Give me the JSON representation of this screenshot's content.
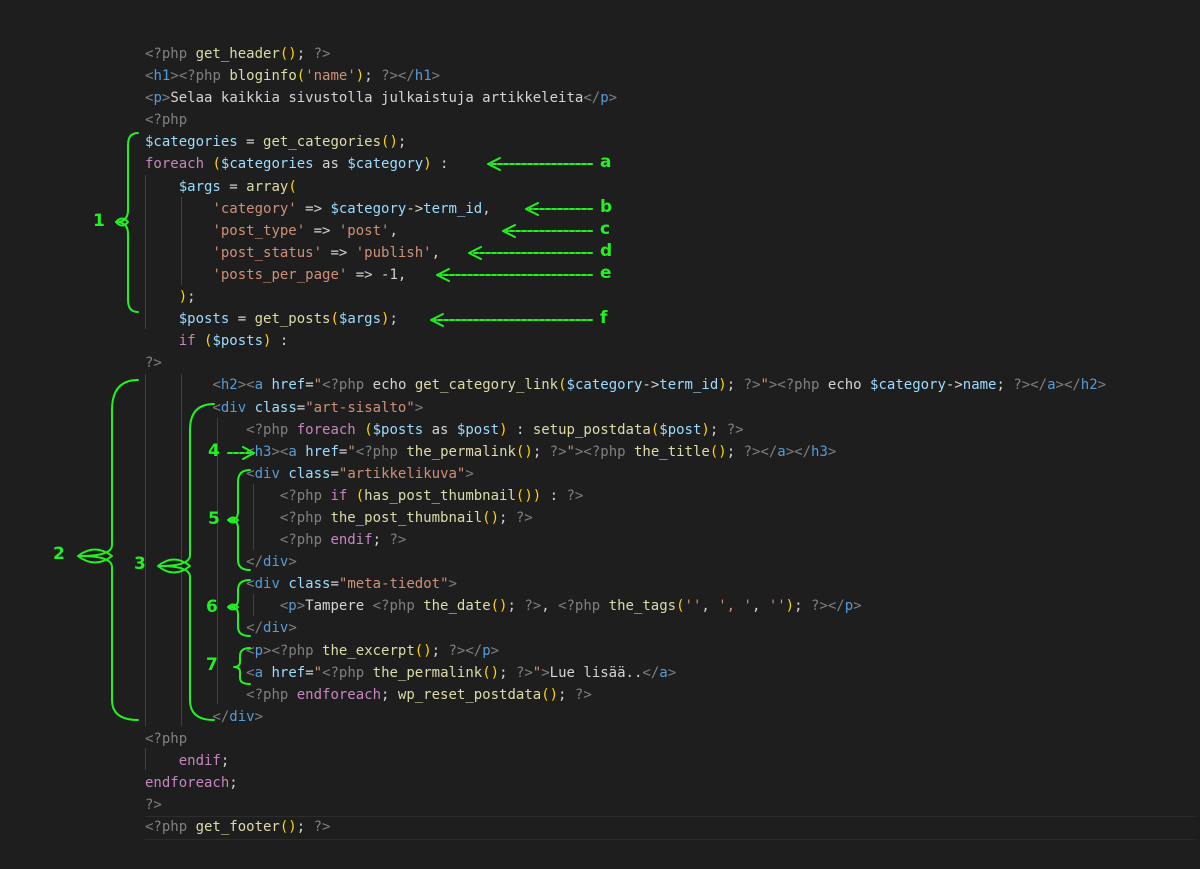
{
  "editor": {
    "lines": [
      [
        [
          "tg",
          "<?php "
        ],
        [
          "fn",
          "get_header"
        ],
        [
          "pn",
          "()"
        ],
        [
          "tx",
          "; "
        ],
        [
          "tg",
          "?>"
        ]
      ],
      [
        [
          "tg",
          "<"
        ],
        [
          "tn",
          "h1"
        ],
        [
          "tg",
          ">"
        ],
        [
          "tg",
          "<?php "
        ],
        [
          "fn",
          "bloginfo"
        ],
        [
          "pn",
          "("
        ],
        [
          "st",
          "'name'"
        ],
        [
          "pn",
          ")"
        ],
        [
          "tx",
          "; "
        ],
        [
          "tg",
          "?>"
        ],
        [
          "tg",
          "</"
        ],
        [
          "tn",
          "h1"
        ],
        [
          "tg",
          ">"
        ]
      ],
      [
        [
          "tg",
          "<"
        ],
        [
          "tn",
          "p"
        ],
        [
          "tg",
          ">"
        ],
        [
          "tx",
          "Selaa kaikkia sivustolla julkaistuja artikkeleita"
        ],
        [
          "tg",
          "</"
        ],
        [
          "tn",
          "p"
        ],
        [
          "tg",
          ">"
        ]
      ],
      [
        [
          "tg",
          "<?php"
        ]
      ],
      [
        [
          "at",
          "$categories"
        ],
        [
          "tx",
          " = "
        ],
        [
          "fn",
          "get_categories"
        ],
        [
          "pn",
          "()"
        ],
        [
          "tx",
          ";"
        ]
      ],
      [
        [
          "kw",
          "foreach"
        ],
        [
          "tx",
          " "
        ],
        [
          "pn",
          "("
        ],
        [
          "at",
          "$categories"
        ],
        [
          "tx",
          " as "
        ],
        [
          "at",
          "$category"
        ],
        [
          "pn",
          ")"
        ],
        [
          "tx",
          " :"
        ]
      ],
      [
        [
          "tx",
          "    "
        ],
        [
          "at",
          "$args"
        ],
        [
          "tx",
          " = "
        ],
        [
          "fn",
          "array"
        ],
        [
          "pn",
          "("
        ]
      ],
      [
        [
          "tx",
          "        "
        ],
        [
          "st",
          "'category'"
        ],
        [
          "tx",
          " => "
        ],
        [
          "at",
          "$category"
        ],
        [
          "tx",
          "->"
        ],
        [
          "at",
          "term_id"
        ],
        [
          "tx",
          ","
        ]
      ],
      [
        [
          "tx",
          "        "
        ],
        [
          "st",
          "'post_type'"
        ],
        [
          "tx",
          " => "
        ],
        [
          "st",
          "'post'"
        ],
        [
          "tx",
          ","
        ]
      ],
      [
        [
          "tx",
          "        "
        ],
        [
          "st",
          "'post_status'"
        ],
        [
          "tx",
          " => "
        ],
        [
          "st",
          "'publish'"
        ],
        [
          "tx",
          ","
        ]
      ],
      [
        [
          "tx",
          "        "
        ],
        [
          "st",
          "'posts_per_page'"
        ],
        [
          "tx",
          " => -1,"
        ]
      ],
      [
        [
          "tx",
          "    "
        ],
        [
          "pn",
          ")"
        ],
        [
          "tx",
          ";"
        ]
      ],
      [
        [
          "tx",
          "    "
        ],
        [
          "at",
          "$posts"
        ],
        [
          "tx",
          " = "
        ],
        [
          "fn",
          "get_posts"
        ],
        [
          "pn",
          "("
        ],
        [
          "at",
          "$args"
        ],
        [
          "pn",
          ")"
        ],
        [
          "tx",
          ";"
        ]
      ],
      [
        [
          "tx",
          "    "
        ],
        [
          "kw",
          "if"
        ],
        [
          "tx",
          " "
        ],
        [
          "pn",
          "("
        ],
        [
          "at",
          "$posts"
        ],
        [
          "pn",
          ")"
        ],
        [
          "tx",
          " :"
        ]
      ],
      [
        [
          "tg",
          "?>"
        ]
      ],
      [
        [
          "tx",
          "        "
        ],
        [
          "tg",
          "<"
        ],
        [
          "tn",
          "h2"
        ],
        [
          "tg",
          ">"
        ],
        [
          "tg",
          "<"
        ],
        [
          "tn",
          "a"
        ],
        [
          "tx",
          " "
        ],
        [
          "at",
          "href"
        ],
        [
          "tx",
          "="
        ],
        [
          "st",
          "\""
        ],
        [
          "tg",
          "<?php "
        ],
        [
          "tx",
          "echo "
        ],
        [
          "fn",
          "get_category_link"
        ],
        [
          "pn",
          "("
        ],
        [
          "at",
          "$category"
        ],
        [
          "tx",
          "->"
        ],
        [
          "at",
          "term_id"
        ],
        [
          "pn",
          ")"
        ],
        [
          "tx",
          "; "
        ],
        [
          "tg",
          "?>"
        ],
        [
          "st",
          "\""
        ],
        [
          "tg",
          ">"
        ],
        [
          "tg",
          "<?php "
        ],
        [
          "tx",
          "echo "
        ],
        [
          "at",
          "$category"
        ],
        [
          "tx",
          "->"
        ],
        [
          "at",
          "name"
        ],
        [
          "tx",
          "; "
        ],
        [
          "tg",
          "?>"
        ],
        [
          "tg",
          "</"
        ],
        [
          "tn",
          "a"
        ],
        [
          "tg",
          ">"
        ],
        [
          "tg",
          "</"
        ],
        [
          "tn",
          "h2"
        ],
        [
          "tg",
          ">"
        ]
      ],
      [
        [
          "tx",
          "        "
        ],
        [
          "tg",
          "<"
        ],
        [
          "tn",
          "div"
        ],
        [
          "tx",
          " "
        ],
        [
          "at",
          "class"
        ],
        [
          "tx",
          "="
        ],
        [
          "st",
          "\"art-sisalto\""
        ],
        [
          "tg",
          ">"
        ]
      ],
      [
        [
          "tx",
          "            "
        ],
        [
          "tg",
          "<?php "
        ],
        [
          "kw",
          "foreach"
        ],
        [
          "tx",
          " "
        ],
        [
          "pn",
          "("
        ],
        [
          "at",
          "$posts"
        ],
        [
          "tx",
          " as "
        ],
        [
          "at",
          "$post"
        ],
        [
          "pn",
          ")"
        ],
        [
          "tx",
          " : "
        ],
        [
          "fn",
          "setup_postdata"
        ],
        [
          "pn",
          "("
        ],
        [
          "at",
          "$post"
        ],
        [
          "pn",
          ")"
        ],
        [
          "tx",
          "; "
        ],
        [
          "tg",
          "?>"
        ]
      ],
      [
        [
          "tx",
          "            "
        ],
        [
          "tg",
          "<"
        ],
        [
          "tn",
          "h3"
        ],
        [
          "tg",
          ">"
        ],
        [
          "tg",
          "<"
        ],
        [
          "tn",
          "a"
        ],
        [
          "tx",
          " "
        ],
        [
          "at",
          "href"
        ],
        [
          "tx",
          "="
        ],
        [
          "st",
          "\""
        ],
        [
          "tg",
          "<?php "
        ],
        [
          "fn",
          "the_permalink"
        ],
        [
          "pn",
          "()"
        ],
        [
          "tx",
          "; "
        ],
        [
          "tg",
          "?>"
        ],
        [
          "st",
          "\""
        ],
        [
          "tg",
          ">"
        ],
        [
          "tg",
          "<?php "
        ],
        [
          "fn",
          "the_title"
        ],
        [
          "pn",
          "()"
        ],
        [
          "tx",
          "; "
        ],
        [
          "tg",
          "?>"
        ],
        [
          "tg",
          "</"
        ],
        [
          "tn",
          "a"
        ],
        [
          "tg",
          ">"
        ],
        [
          "tg",
          "</"
        ],
        [
          "tn",
          "h3"
        ],
        [
          "tg",
          ">"
        ]
      ],
      [
        [
          "tx",
          "            "
        ],
        [
          "tg",
          "<"
        ],
        [
          "tn",
          "div"
        ],
        [
          "tx",
          " "
        ],
        [
          "at",
          "class"
        ],
        [
          "tx",
          "="
        ],
        [
          "st",
          "\"artikkelikuva\""
        ],
        [
          "tg",
          ">"
        ]
      ],
      [
        [
          "tx",
          "                "
        ],
        [
          "tg",
          "<?php "
        ],
        [
          "kw",
          "if"
        ],
        [
          "tx",
          " "
        ],
        [
          "pn",
          "("
        ],
        [
          "fn",
          "has_post_thumbnail"
        ],
        [
          "pn",
          "()"
        ],
        [
          "pn",
          ")"
        ],
        [
          "tx",
          " : "
        ],
        [
          "tg",
          "?>"
        ]
      ],
      [
        [
          "tx",
          "                "
        ],
        [
          "tg",
          "<?php "
        ],
        [
          "fn",
          "the_post_thumbnail"
        ],
        [
          "pn",
          "()"
        ],
        [
          "tx",
          "; "
        ],
        [
          "tg",
          "?>"
        ]
      ],
      [
        [
          "tx",
          "                "
        ],
        [
          "tg",
          "<?php "
        ],
        [
          "kw",
          "endif"
        ],
        [
          "tx",
          "; "
        ],
        [
          "tg",
          "?>"
        ]
      ],
      [
        [
          "tx",
          "            "
        ],
        [
          "tg",
          "</"
        ],
        [
          "tn",
          "div"
        ],
        [
          "tg",
          ">"
        ]
      ],
      [
        [
          "tx",
          "            "
        ],
        [
          "tg",
          "<"
        ],
        [
          "tn",
          "div"
        ],
        [
          "tx",
          " "
        ],
        [
          "at",
          "class"
        ],
        [
          "tx",
          "="
        ],
        [
          "st",
          "\"meta-tiedot\""
        ],
        [
          "tg",
          ">"
        ]
      ],
      [
        [
          "tx",
          "                "
        ],
        [
          "tg",
          "<"
        ],
        [
          "tn",
          "p"
        ],
        [
          "tg",
          ">"
        ],
        [
          "tx",
          "Tampere "
        ],
        [
          "tg",
          "<?php "
        ],
        [
          "fn",
          "the_date"
        ],
        [
          "pn",
          "()"
        ],
        [
          "tx",
          "; "
        ],
        [
          "tg",
          "?>"
        ],
        [
          "tx",
          ", "
        ],
        [
          "tg",
          "<?php "
        ],
        [
          "fn",
          "the_tags"
        ],
        [
          "pn",
          "("
        ],
        [
          "st",
          "''"
        ],
        [
          "tx",
          ", "
        ],
        [
          "st",
          "', '"
        ],
        [
          "tx",
          ", "
        ],
        [
          "st",
          "''"
        ],
        [
          "pn",
          ")"
        ],
        [
          "tx",
          "; "
        ],
        [
          "tg",
          "?>"
        ],
        [
          "tg",
          "</"
        ],
        [
          "tn",
          "p"
        ],
        [
          "tg",
          ">"
        ]
      ],
      [
        [
          "tx",
          "            "
        ],
        [
          "tg",
          "</"
        ],
        [
          "tn",
          "div"
        ],
        [
          "tg",
          ">"
        ]
      ],
      [
        [
          "tx",
          "            "
        ],
        [
          "tg",
          "<"
        ],
        [
          "tn",
          "p"
        ],
        [
          "tg",
          ">"
        ],
        [
          "tg",
          "<?php "
        ],
        [
          "fn",
          "the_excerpt"
        ],
        [
          "pn",
          "()"
        ],
        [
          "tx",
          "; "
        ],
        [
          "tg",
          "?>"
        ],
        [
          "tg",
          "</"
        ],
        [
          "tn",
          "p"
        ],
        [
          "tg",
          ">"
        ]
      ],
      [
        [
          "tx",
          "            "
        ],
        [
          "tg",
          "<"
        ],
        [
          "tn",
          "a"
        ],
        [
          "tx",
          " "
        ],
        [
          "at",
          "href"
        ],
        [
          "tx",
          "="
        ],
        [
          "st",
          "\""
        ],
        [
          "tg",
          "<?php "
        ],
        [
          "fn",
          "the_permalink"
        ],
        [
          "pn",
          "()"
        ],
        [
          "tx",
          "; "
        ],
        [
          "tg",
          "?>"
        ],
        [
          "st",
          "\""
        ],
        [
          "tg",
          ">"
        ],
        [
          "tx",
          "Lue lisää.."
        ],
        [
          "tg",
          "</"
        ],
        [
          "tn",
          "a"
        ],
        [
          "tg",
          ">"
        ]
      ],
      [
        [
          "tx",
          "            "
        ],
        [
          "tg",
          "<?php "
        ],
        [
          "kw",
          "endforeach"
        ],
        [
          "tx",
          "; "
        ],
        [
          "fn",
          "wp_reset_postdata"
        ],
        [
          "pn",
          "()"
        ],
        [
          "tx",
          "; "
        ],
        [
          "tg",
          "?>"
        ]
      ],
      [
        [
          "tx",
          "        "
        ],
        [
          "tg",
          "</"
        ],
        [
          "tn",
          "div"
        ],
        [
          "tg",
          ">"
        ]
      ],
      [
        [
          "tg",
          "<?php"
        ]
      ],
      [
        [
          "tx",
          "    "
        ],
        [
          "kw",
          "endif"
        ],
        [
          "tx",
          ";"
        ]
      ],
      [
        [
          "kw",
          "endforeach"
        ],
        [
          "tx",
          ";"
        ]
      ],
      [
        [
          "tg",
          "?>"
        ]
      ],
      [
        [
          "tg",
          "<?php "
        ],
        [
          "fn",
          "get_footer"
        ],
        [
          "pn",
          "()"
        ],
        [
          "tx",
          "; "
        ],
        [
          "tg",
          "?>"
        ]
      ]
    ]
  },
  "annotations": {
    "color": "#21f221",
    "labels": [
      "a",
      "b",
      "c",
      "d",
      "e",
      "f",
      "1",
      "2",
      "3",
      "4",
      "5",
      "6",
      "7"
    ]
  }
}
